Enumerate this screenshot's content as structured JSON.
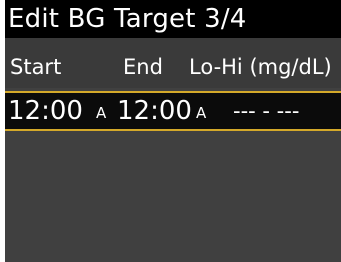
{
  "title": "Edit BG Target 3/4",
  "columns": {
    "start": "Start",
    "end": "End",
    "range": "Lo-Hi (mg/dL)"
  },
  "selected_row": {
    "start_time": "12:00",
    "start_period": "A",
    "end_time": "12:00",
    "end_period": "A",
    "range": "--- - ---"
  },
  "colors": {
    "background": "#404040",
    "title_bar": "#000000",
    "selection_border": "#d4a92a",
    "text": "#ffffff"
  }
}
